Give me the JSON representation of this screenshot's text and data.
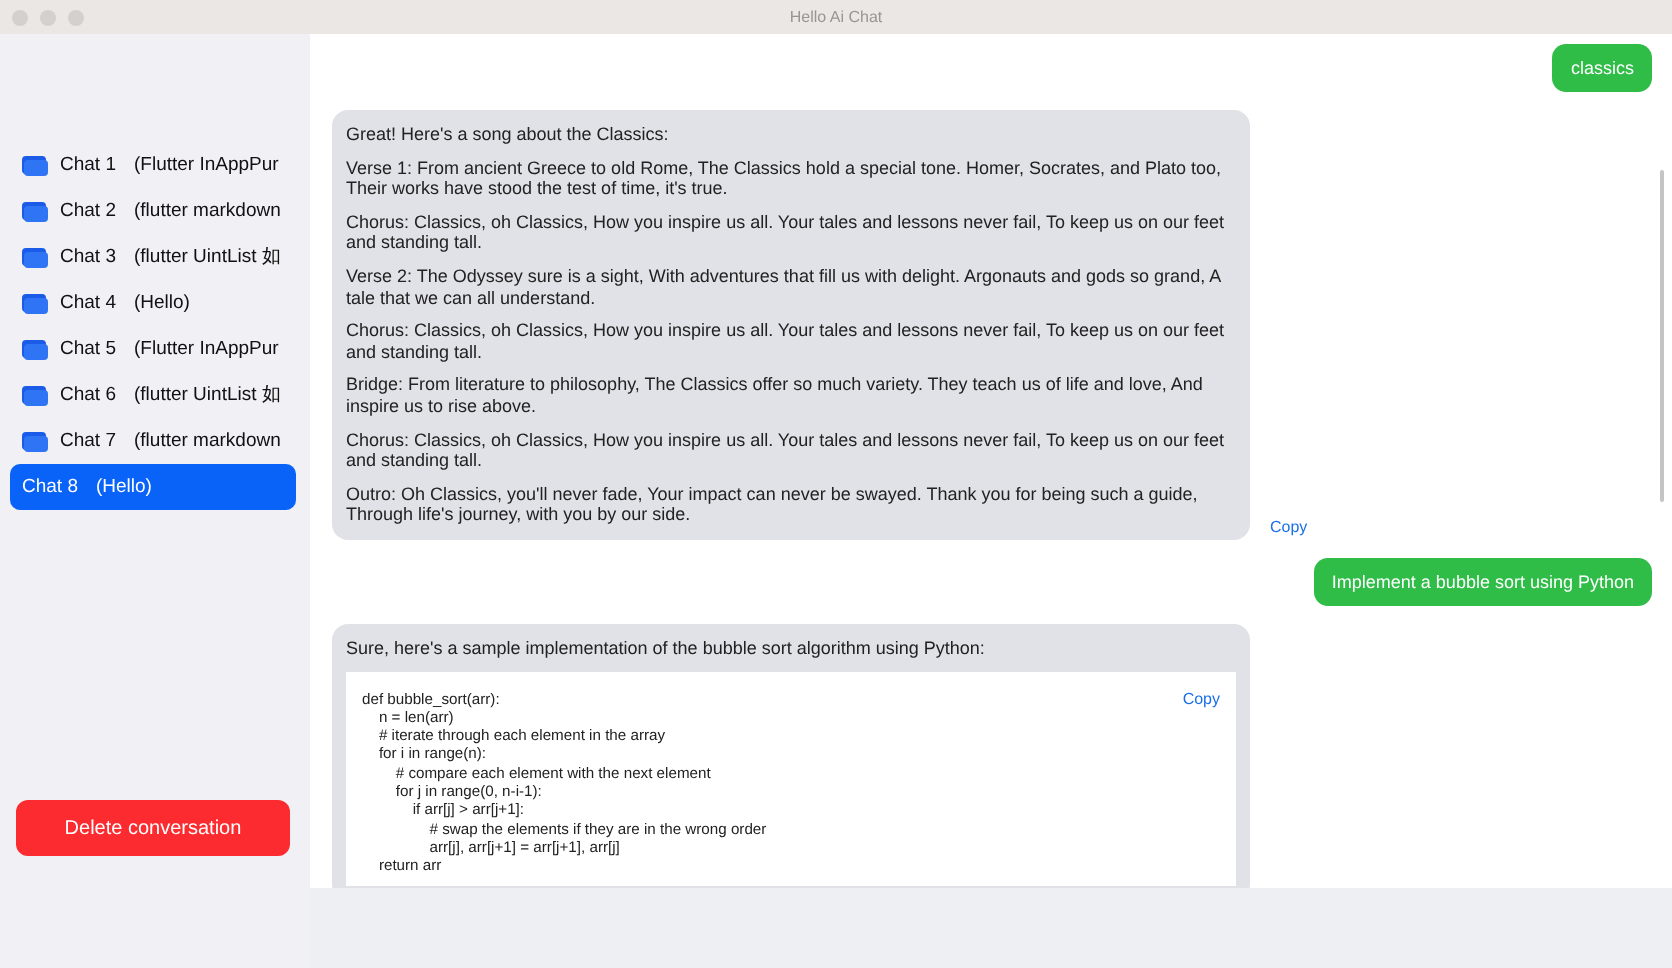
{
  "window": {
    "title": "Hello Ai Chat"
  },
  "sidebar": {
    "chats": [
      {
        "label": "Chat 1",
        "title": "(Flutter InAppPur",
        "selected": false
      },
      {
        "label": "Chat 2",
        "title": "(flutter markdown",
        "selected": false
      },
      {
        "label": "Chat 3",
        "title": "(flutter UintList 如",
        "selected": false
      },
      {
        "label": "Chat 4",
        "title": "(Hello)",
        "selected": false
      },
      {
        "label": "Chat 5",
        "title": "(Flutter InAppPur",
        "selected": false
      },
      {
        "label": "Chat 6",
        "title": "(flutter UintList 如",
        "selected": false
      },
      {
        "label": "Chat 7",
        "title": "(flutter markdown",
        "selected": false
      },
      {
        "label": "Chat 8",
        "title": "(Hello)",
        "selected": true
      }
    ],
    "delete_button": "Delete conversation"
  },
  "messages": [
    {
      "kind": "user",
      "text": "classics"
    },
    {
      "kind": "assistant",
      "paragraphs": [
        "Great! Here's a song about the Classics:",
        "Verse 1: From ancient Greece to old Rome, The Classics hold a special tone. Homer, Socrates, and Plato too, Their works have stood the test of time, it's true.",
        "Chorus: Classics, oh Classics, How you inspire us all. Your tales and lessons never fail, To keep us on our feet and standing tall.",
        "Verse 2: The Odyssey sure is a sight, With adventures that fill us with delight. Argonauts and gods so grand, A tale that we can all understand.",
        "Chorus: Classics, oh Classics, How you inspire us all. Your tales and lessons never fail, To keep us on our feet and standing tall.",
        "Bridge: From literature to philosophy, The Classics offer so much variety. They teach us of life and love, And inspire us to rise above.",
        "Chorus: Classics, oh Classics, How you inspire us all. Your tales and lessons never fail, To keep us on our feet and standing tall.",
        "Outro: Oh Classics, you'll never fade, Your impact can never be swayed. Thank you for being such a guide, Through life's journey, with you by our side."
      ],
      "copy": "Copy"
    },
    {
      "kind": "user",
      "text": "Implement a bubble sort using Python"
    },
    {
      "kind": "assistant",
      "paragraphs": [
        "Sure, here's a sample implementation of the bubble sort algorithm using Python:"
      ],
      "code": {
        "text": "def bubble_sort(arr):\n    n = len(arr)\n    # iterate through each element in the array\n    for i in range(n):\n        # compare each element with the next element\n        for j in range(0, n-i-1):\n            if arr[j] > arr[j+1]:\n                # swap the elements if they are in the wrong order\n                arr[j], arr[j+1] = arr[j+1], arr[j]\n    return arr",
        "copy": "Copy"
      }
    }
  ]
}
